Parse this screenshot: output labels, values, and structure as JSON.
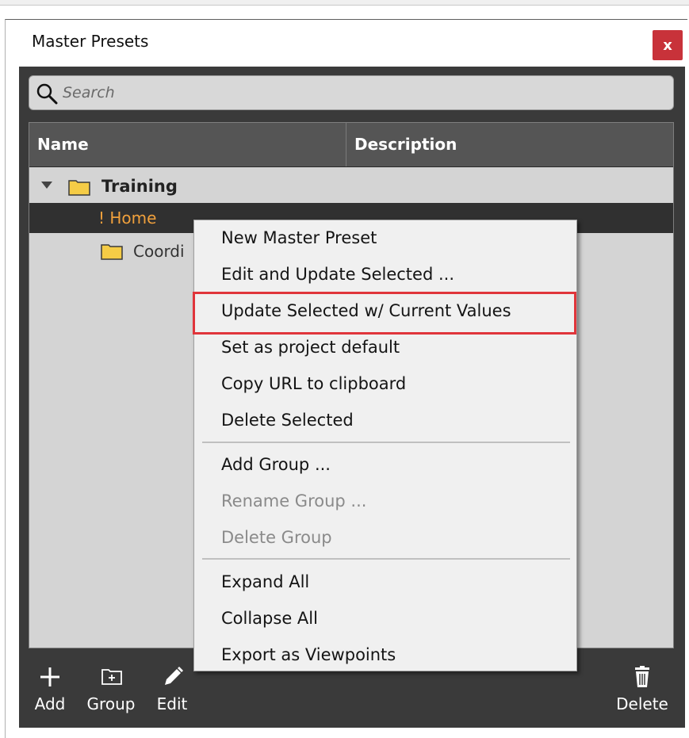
{
  "window": {
    "title": "Master Presets",
    "close_label": "x"
  },
  "search": {
    "placeholder": "Search"
  },
  "columns": {
    "name": "Name",
    "description": "Description"
  },
  "tree": {
    "group": "Training",
    "selected_item": "! Home",
    "subgroup": "Coordi"
  },
  "context_menu": {
    "items": [
      "New Master Preset",
      "Edit and Update Selected ...",
      "Update Selected w/ Current Values",
      "Set as project default",
      "Copy URL to clipboard",
      "Delete Selected",
      "Add Group ...",
      "Rename Group ...",
      "Delete Group",
      "Expand All",
      "Collapse All",
      "Export as Viewpoints"
    ],
    "disabled": [
      "Rename Group ...",
      "Delete Group"
    ],
    "highlighted": "Update Selected w/ Current Values"
  },
  "toolbar": {
    "add": "Add",
    "group": "Group",
    "edit": "Edit",
    "delete": "Delete"
  },
  "colors": {
    "panel_bg": "#3a3a3a",
    "selected_text": "#f0a03c",
    "highlight_border": "#e0353b",
    "close_bg": "#c8323a"
  }
}
